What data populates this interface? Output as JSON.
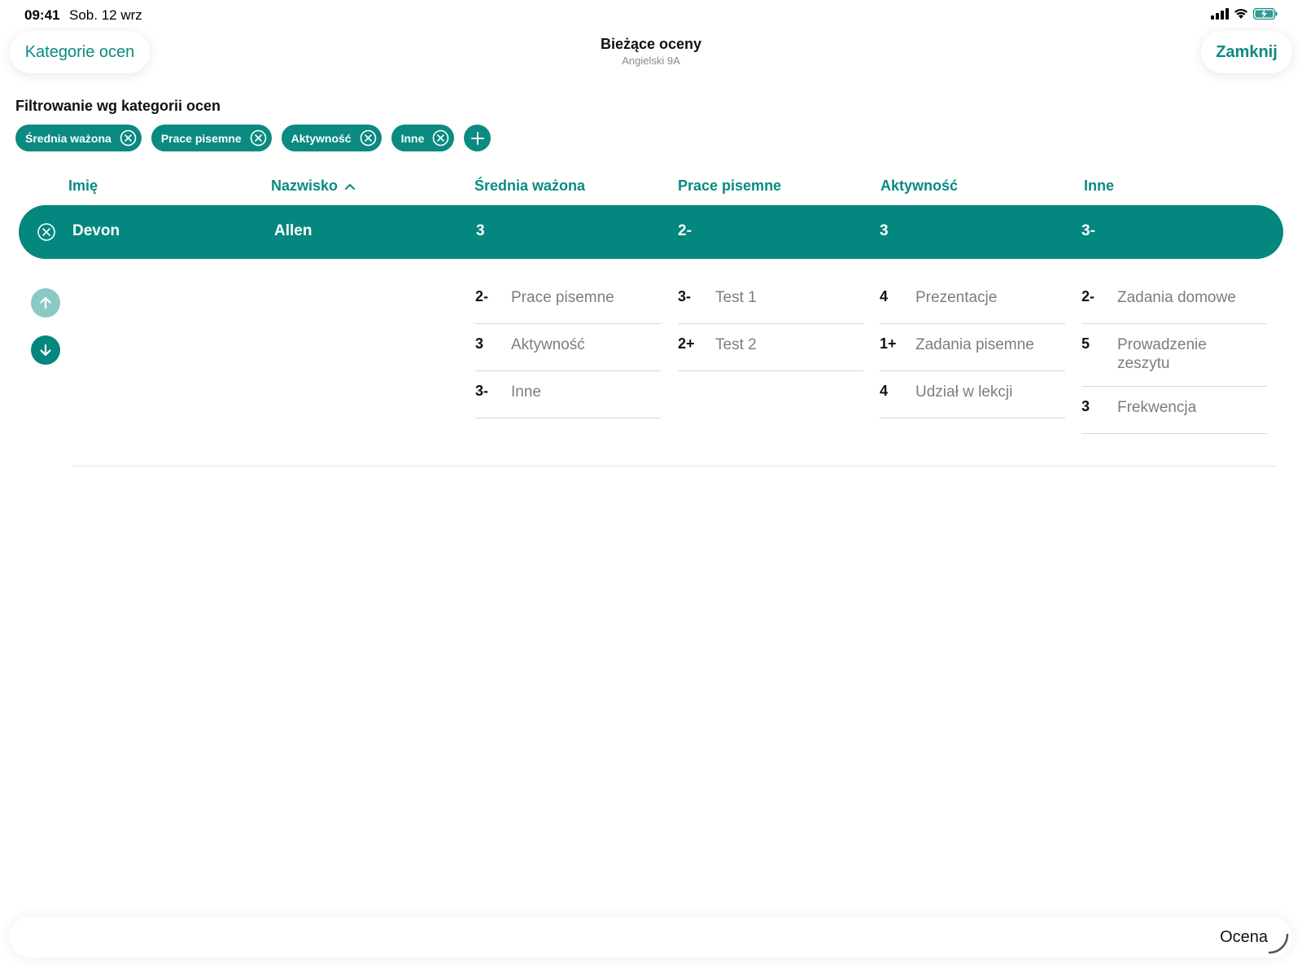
{
  "status_bar": {
    "time": "09:41",
    "date": "Sob. 12 wrz"
  },
  "header": {
    "left_button": "Kategorie ocen",
    "title": "Bieżące oceny",
    "subtitle": "Angielski 9A",
    "right_button": "Zamknij"
  },
  "filter": {
    "label": "Filtrowanie wg kategorii ocen",
    "chips": [
      "Średnia ważona",
      "Prace pisemne",
      "Aktywność",
      "Inne"
    ]
  },
  "table": {
    "columns": [
      "Imię",
      "Nazwisko",
      "Średnia ważona",
      "Prace pisemne",
      "Aktywność",
      "Inne"
    ],
    "selected_row": {
      "first_name": "Devon",
      "last_name": "Allen",
      "grades": [
        "3",
        "2-",
        "3",
        "3-"
      ]
    }
  },
  "details": {
    "srednia": [
      {
        "grade": "2-",
        "name": "Prace pisemne"
      },
      {
        "grade": "3",
        "name": "Aktywność"
      },
      {
        "grade": "3-",
        "name": "Inne"
      }
    ],
    "prace": [
      {
        "grade": "3-",
        "name": "Test 1"
      },
      {
        "grade": "2+",
        "name": "Test 2"
      }
    ],
    "aktywnosc": [
      {
        "grade": "4",
        "name": "Prezentacje"
      },
      {
        "grade": "1+",
        "name": "Zadania pisemne"
      },
      {
        "grade": "4",
        "name": "Udział w lekcji"
      }
    ],
    "inne": [
      {
        "grade": "2-",
        "name": "Zadania domowe"
      },
      {
        "grade": "5",
        "name": "Prowadzenie zeszytu"
      },
      {
        "grade": "3",
        "name": "Frekwencja"
      }
    ]
  },
  "bottom_bar": {
    "label": "Ocena"
  },
  "colors": {
    "accent": "#0a8a80",
    "row": "#04877f",
    "arrow_disabled": "#8cc9c4"
  }
}
